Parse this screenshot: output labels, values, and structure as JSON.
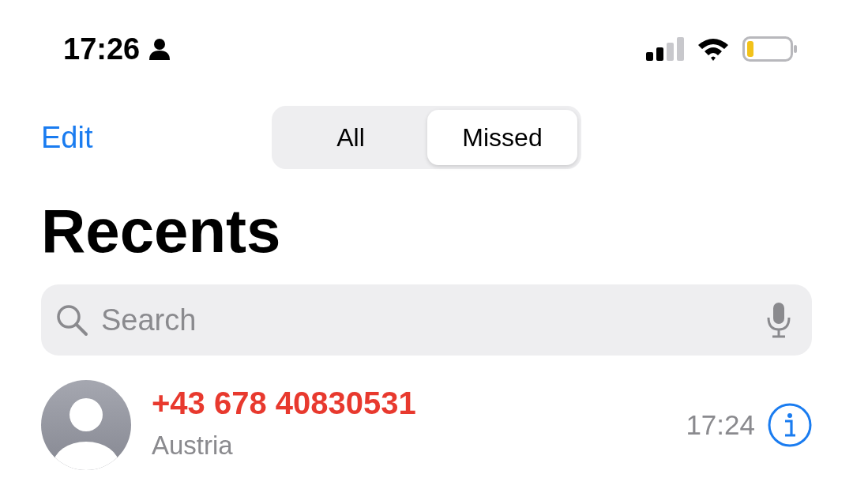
{
  "status_bar": {
    "time": "17:26"
  },
  "nav": {
    "edit": "Edit",
    "segments": [
      {
        "label": "All",
        "selected": false
      },
      {
        "label": "Missed",
        "selected": true
      }
    ]
  },
  "title": "Recents",
  "search": {
    "placeholder": "Search"
  },
  "calls": [
    {
      "number": "+43 678 40830531",
      "location": "Austria",
      "time": "17:24",
      "missed": true
    }
  ]
}
